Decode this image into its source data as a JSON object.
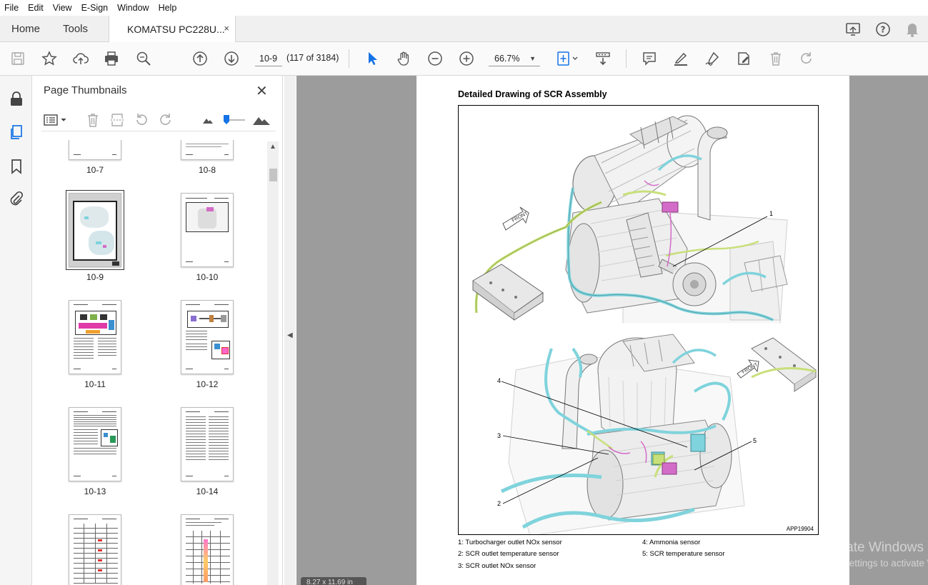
{
  "menu": [
    "File",
    "Edit",
    "View",
    "E-Sign",
    "Window",
    "Help"
  ],
  "tabs": {
    "home": "Home",
    "tools": "Tools",
    "document": "KOMATSU PC228U...",
    "close": "×"
  },
  "toolbar": {
    "page_input": "10-9",
    "page_count": "(117 of 3184)",
    "zoom": "66.7%",
    "zoom_caret": "▼"
  },
  "panel": {
    "title": "Page Thumbnails",
    "close": "✕",
    "thumbnails": [
      {
        "label": "10-7"
      },
      {
        "label": "10-8"
      },
      {
        "label": "10-9",
        "selected": true
      },
      {
        "label": "10-10"
      },
      {
        "label": "10-11"
      },
      {
        "label": "10-12"
      },
      {
        "label": "10-13"
      },
      {
        "label": "10-14"
      },
      {
        "label": ""
      },
      {
        "label": ""
      }
    ]
  },
  "document": {
    "heading": "Detailed Drawing of SCR Assembly",
    "figure_code": "APP19904",
    "callouts": [
      "1",
      "2",
      "3",
      "4",
      "5"
    ],
    "front_label": "FRONT",
    "legend": [
      "1: Turbocharger outlet NOx sensor",
      "2: SCR outlet temperature sensor",
      "3: SCR outlet NOx sensor",
      "4: Ammonia sensor",
      "5: SCR temperature sensor"
    ],
    "page_size": "8.27 x 11.69 in"
  },
  "watermark": {
    "line1": "Activate Windows",
    "line2": "Go to Settings to activate Windows."
  },
  "colors": {
    "accent": "#1473e6",
    "hose_cyan": "#7fd3dc",
    "harness_green": "#c8e07a",
    "sensor_magenta": "#d36cc8"
  }
}
